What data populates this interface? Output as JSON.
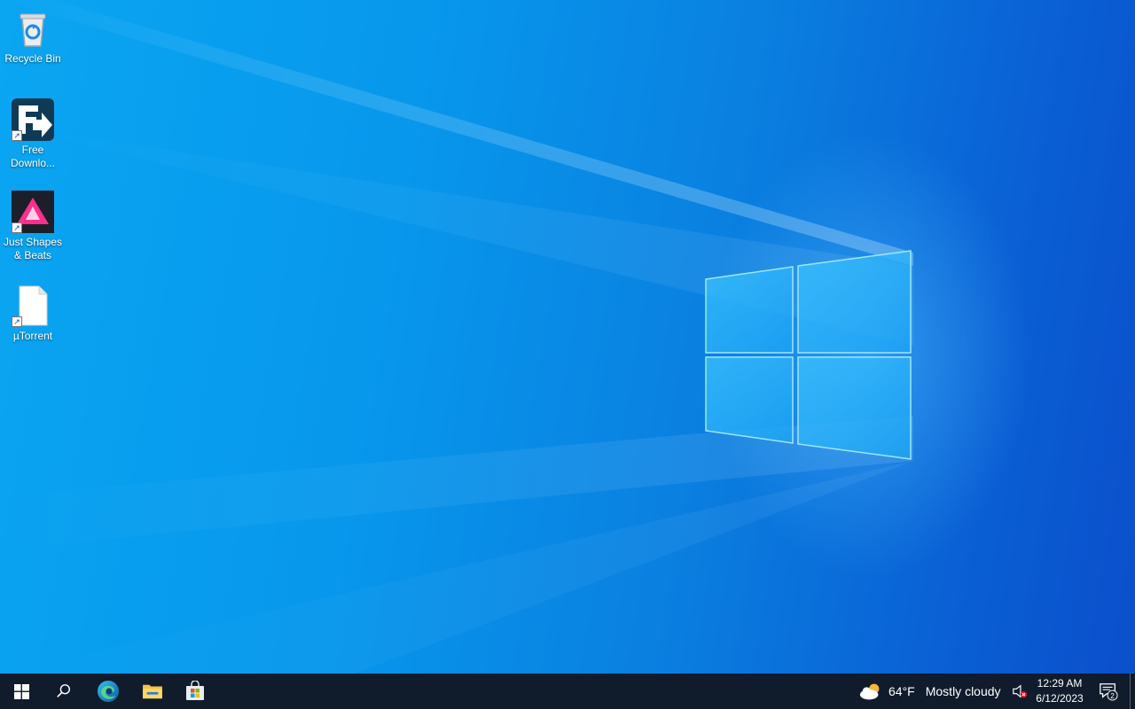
{
  "desktop": {
    "icons": [
      {
        "label": "Recycle Bin",
        "icon": "recycle-bin-icon",
        "shortcut": false
      },
      {
        "label": "Free Downlo...",
        "icon": "free-download-manager-icon",
        "shortcut": true
      },
      {
        "label": "Just Shapes & Beats",
        "icon": "just-shapes-and-beats-icon",
        "shortcut": true
      },
      {
        "label": "µTorrent",
        "icon": "blank-file-icon",
        "shortcut": true
      }
    ]
  },
  "taskbar": {
    "pinned": [
      {
        "name": "start",
        "icon": "windows-start-icon"
      },
      {
        "name": "search",
        "icon": "search-icon"
      },
      {
        "name": "edge",
        "icon": "edge-browser-icon"
      },
      {
        "name": "file-explorer",
        "icon": "folder-icon"
      },
      {
        "name": "store",
        "icon": "microsoft-store-icon"
      }
    ],
    "weather": {
      "temp": "64°F",
      "condition": "Mostly cloudy",
      "icon": "partly-cloudy-icon"
    },
    "volume_icon": "volume-muted-icon",
    "clock": {
      "time": "12:29 AM",
      "date": "6/12/2023"
    },
    "notifications": {
      "count": "2",
      "icon": "notification-center-icon"
    }
  },
  "colors": {
    "wallpaper_light": "#0aa6f2",
    "wallpaper_dark": "#0b4fcc",
    "taskbar": "#101c2c"
  }
}
